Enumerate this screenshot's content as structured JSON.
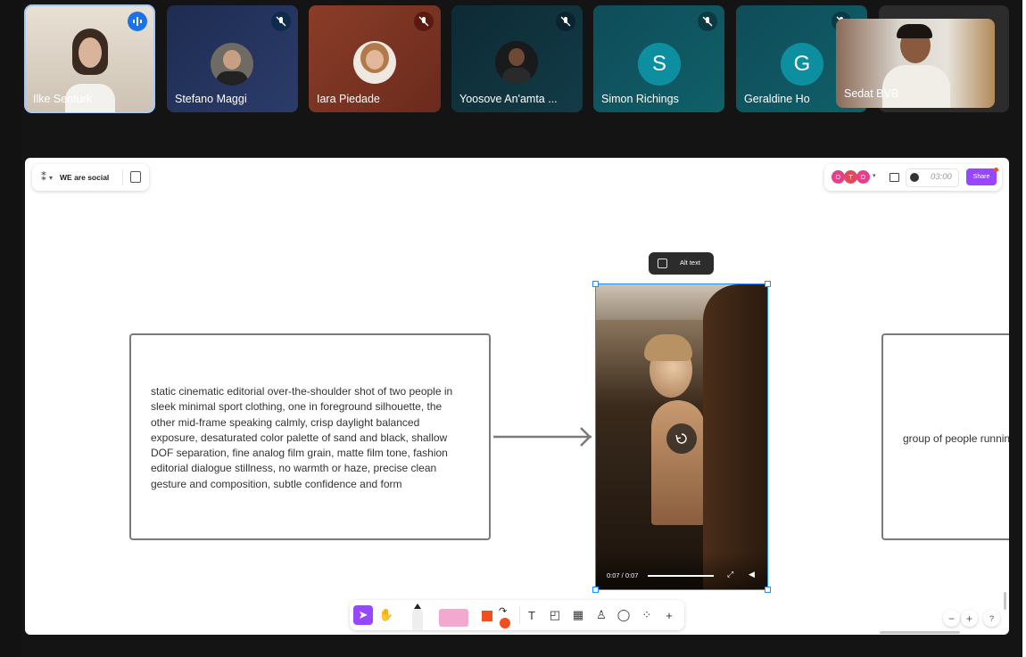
{
  "participants": [
    {
      "name": "Ilke Senturk",
      "speaking": true
    },
    {
      "name": "Stefano Maggi",
      "muted": true
    },
    {
      "name": "Iara Piedade",
      "muted": true
    },
    {
      "name": "Yoosove An'amta ...",
      "muted": true
    },
    {
      "name": "Simon Richings",
      "initial": "S",
      "muted": true
    },
    {
      "name": "Geraldine Ho",
      "initial": "G",
      "muted": true
    },
    {
      "name": "Sedat BVB"
    }
  ],
  "board": {
    "file_name": "WE are social",
    "collaborators": [
      "D",
      "T",
      "D"
    ],
    "timer": "03:00",
    "share_label": "Share",
    "alt_text_label": "Alt text",
    "prompt_left": "static cinematic editorial over-the-shoulder shot of two people in sleek minimal sport clothing, one in foreground silhouette, the other mid-frame speaking calmly, crisp daylight balanced exposure, desaturated color palette of sand and black, shallow DOF separation, fine analog film grain, matte film tone, fashion editorial dialogue stillness, no warmth or haze, precise clean gesture and composition, subtle confidence and form",
    "prompt_right": "group of people runnin",
    "video_time": "0:07 / 0:07"
  },
  "colors": {
    "accent": "#9747ff",
    "selection": "#1e90ff",
    "collab1": "#e83e8c",
    "collab2": "#e24a59",
    "shape": "#f24e1e"
  }
}
